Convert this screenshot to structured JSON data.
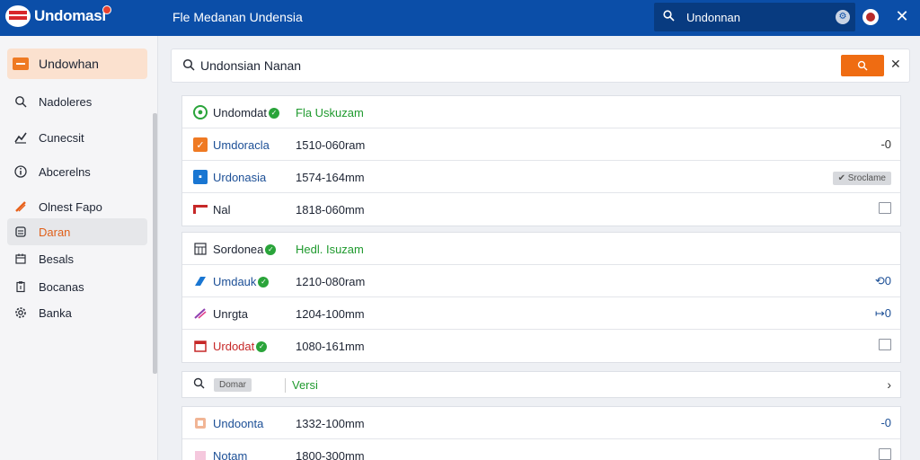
{
  "topbar": {
    "logo_text": "Undomasi",
    "title": "Fle Medanan Undensia",
    "search_value": "Undonnan",
    "search_icon": "search-icon",
    "settings_icon": "gear-icon",
    "close_glyph": "✕"
  },
  "sidebar": {
    "items": [
      {
        "label": "Undowhan",
        "icon": "app-icon"
      },
      {
        "label": "Nadoleres",
        "icon": "search-icon"
      },
      {
        "label": "Cunecsit",
        "icon": "chart-icon"
      },
      {
        "label": "Abcerelns",
        "icon": "info-icon"
      },
      {
        "label": "Olnest Fapo",
        "icon": "brush-icon"
      },
      {
        "label": "Daran",
        "icon": "database-icon"
      },
      {
        "label": "Besals",
        "icon": "calendar-icon"
      },
      {
        "label": "Bocanas",
        "icon": "clipboard-icon"
      },
      {
        "label": "Banka",
        "icon": "gear-icon"
      }
    ]
  },
  "search": {
    "value": "Undonsian Nanan",
    "button_glyph": "⚲",
    "clear_glyph": "✕"
  },
  "group1": {
    "header": {
      "name": "Undomdat",
      "time": "Fla Uskuzam"
    },
    "rows": [
      {
        "name": "Umdoracla",
        "time": "1510-060ram",
        "right": "-0"
      },
      {
        "name": "Urdonasia",
        "time": "1574-164mm",
        "right_chip": "✔ Sroclame"
      },
      {
        "name": "Nal",
        "time": "1818-060mm"
      }
    ]
  },
  "group2": {
    "header": {
      "name": "Sordonea",
      "time": "Hedl. Isuzam"
    },
    "rows": [
      {
        "name": "Umdauk",
        "time": "1210-080ram",
        "right": "⟲0"
      },
      {
        "name": "Unrgta",
        "time": "1204-100mm",
        "right": "↦0"
      },
      {
        "name": "Urdodat",
        "time": "1080-161mm"
      }
    ]
  },
  "filter": {
    "chip": "Domar",
    "version": "Versi",
    "chevron": "›"
  },
  "group3": {
    "rows": [
      {
        "name": "Undoonta",
        "time": "1332-100mm",
        "right": "-0"
      },
      {
        "name": "Notam",
        "time": "1800-300mm"
      }
    ]
  }
}
